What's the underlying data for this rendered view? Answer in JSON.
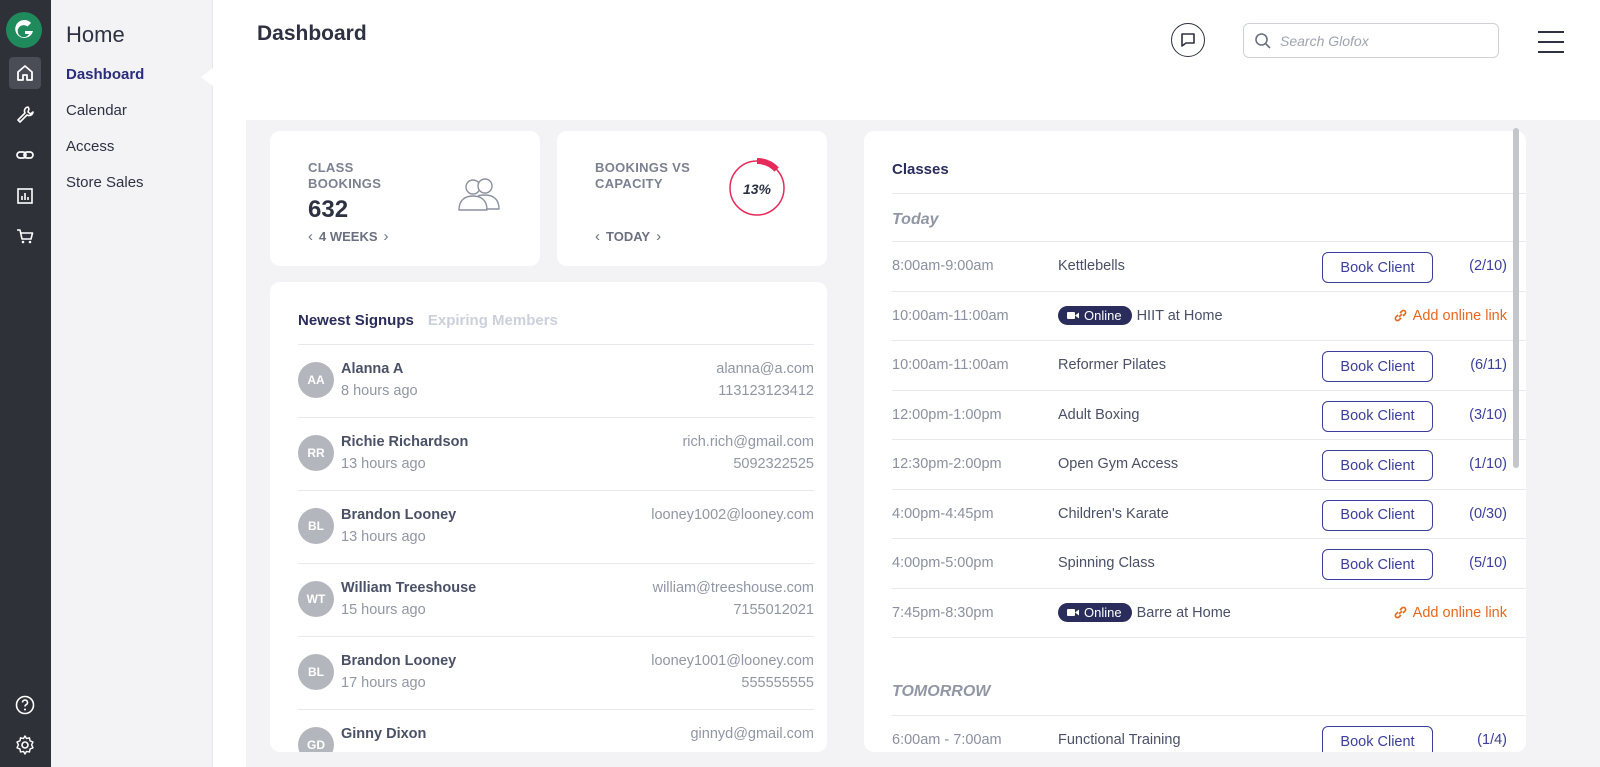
{
  "sidebar": {
    "title": "Home",
    "items": [
      {
        "label": "Dashboard",
        "active": true
      },
      {
        "label": "Calendar"
      },
      {
        "label": "Access"
      },
      {
        "label": "Store Sales"
      }
    ]
  },
  "header": {
    "title": "Dashboard",
    "search_placeholder": "Search Glofox"
  },
  "stats": {
    "class_bookings": {
      "label": "CLASS BOOKINGS",
      "value": "632",
      "period": "4 WEEKS"
    },
    "capacity": {
      "label": "BOOKINGS VS CAPACITY",
      "percent_text": "13%",
      "percent": 13,
      "period": "TODAY"
    }
  },
  "signups": {
    "tab_active": "Newest Signups",
    "tab_inactive": "Expiring Members",
    "rows": [
      {
        "initials": "AA",
        "name": "Alanna A",
        "time": "8 hours ago",
        "email": "alanna@a.com",
        "phone": "113123123412"
      },
      {
        "initials": "RR",
        "name": "Richie Richardson",
        "time": "13 hours ago",
        "email": "rich.rich@gmail.com",
        "phone": "5092322525"
      },
      {
        "initials": "BL",
        "name": "Brandon Looney",
        "time": "13 hours ago",
        "email": "looney1002@looney.com",
        "phone": ""
      },
      {
        "initials": "WT",
        "name": "William Treeshouse",
        "time": "15 hours ago",
        "email": "william@treeshouse.com",
        "phone": "7155012021"
      },
      {
        "initials": "BL",
        "name": "Brandon Looney",
        "time": "17 hours ago",
        "email": "looney1001@looney.com",
        "phone": "555555555"
      },
      {
        "initials": "GD",
        "name": "Ginny Dixon",
        "time": "",
        "email": "ginnyd@gmail.com",
        "phone": ""
      }
    ]
  },
  "classes": {
    "title": "Classes",
    "today_label": "Today",
    "tomorrow_label": "TOMORROW",
    "book_label": "Book Client",
    "online_label": "Online",
    "add_link_label": "Add online link",
    "today": [
      {
        "time": "8:00am-9:00am",
        "name": "Kettlebells",
        "online": false,
        "capacity": "(2/10)"
      },
      {
        "time": "10:00am-11:00am",
        "name": "HIIT at Home",
        "online": true,
        "capacity": ""
      },
      {
        "time": "10:00am-11:00am",
        "name": "Reformer Pilates",
        "online": false,
        "capacity": "(6/11)"
      },
      {
        "time": "12:00pm-1:00pm",
        "name": "Adult Boxing",
        "online": false,
        "capacity": "(3/10)"
      },
      {
        "time": "12:30pm-2:00pm",
        "name": "Open Gym Access",
        "online": false,
        "capacity": "(1/10)"
      },
      {
        "time": "4:00pm-4:45pm",
        "name": "Children's Karate",
        "online": false,
        "capacity": "(0/30)"
      },
      {
        "time": "4:00pm-5:00pm",
        "name": "Spinning Class",
        "online": false,
        "capacity": "(5/10)"
      },
      {
        "time": "7:45pm-8:30pm",
        "name": "Barre at Home",
        "online": true,
        "capacity": ""
      }
    ],
    "tomorrow": [
      {
        "time": "6:00am - 7:00am",
        "name": "Functional Training",
        "online": false,
        "capacity": "(1/4)"
      }
    ]
  }
}
